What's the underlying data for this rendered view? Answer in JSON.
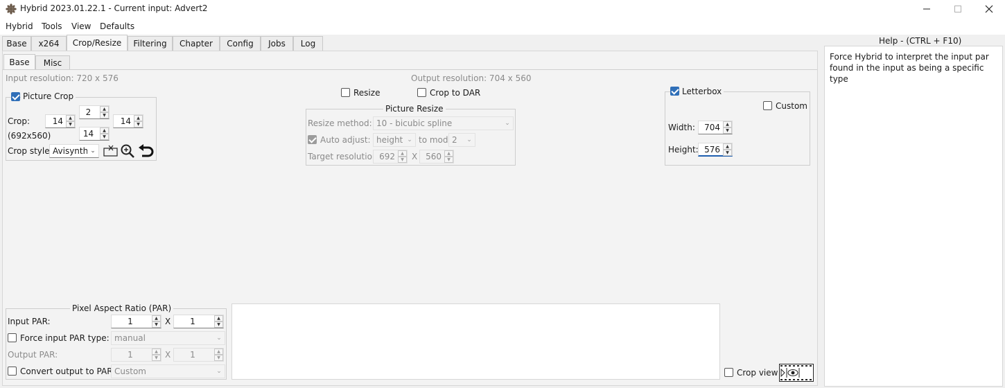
{
  "window": {
    "title": "Hybrid 2023.01.22.1 - Current input: Advert2"
  },
  "menu": [
    "Hybrid",
    "Tools",
    "View",
    "Defaults"
  ],
  "main_tabs": [
    "Base",
    "x264",
    "Crop/Resize",
    "Filtering",
    "Chapter",
    "Config",
    "Jobs",
    "Log"
  ],
  "active_main_tab": "Crop/Resize",
  "sub_tabs": [
    "Base",
    "Misc"
  ],
  "active_sub_tab": "Base",
  "resolution": {
    "input": "Input resolution: 720 x 576",
    "output": "Output resolution: 704 x 560"
  },
  "picture_crop": {
    "title": "Picture Crop",
    "checked": true,
    "crop_label": "Crop:",
    "top": "2",
    "left": "14",
    "right": "14",
    "bottom": "14",
    "dims": "(692x560)",
    "style_label": "Crop style:",
    "style_value": "Avisynth"
  },
  "resize": {
    "resize_label": "Resize",
    "resize_checked": false,
    "crop_to_dar_label": "Crop to DAR",
    "crop_to_dar_checked": false,
    "group_title": "Picture Resize",
    "method_label": "Resize method:",
    "method_value": "10 - bicubic spline",
    "auto_adjust_label": "Auto adjust:",
    "auto_adjust_checked": true,
    "auto_adjust_value": "height",
    "to_mod_label": "to mod",
    "mod_value": "2",
    "target_label": "Target resolution:",
    "target_w": "692",
    "target_x": "X",
    "target_h": "560"
  },
  "letterbox": {
    "label": "Letterbox",
    "checked": true,
    "custom_label": "Custom",
    "custom_checked": false,
    "width_label": "Width:",
    "width": "704",
    "height_label": "Height:",
    "height": "576"
  },
  "par": {
    "title": "Pixel Aspect Ratio (PAR)",
    "input_label": "Input PAR:",
    "input_a": "1",
    "input_x": "X",
    "input_b": "1",
    "force_label": "Force input PAR type:",
    "force_checked": false,
    "force_value": "manual",
    "output_label": "Output PAR:",
    "output_a": "1",
    "output_x": "X",
    "output_b": "1",
    "convert_label": "Convert output to PAR:",
    "convert_checked": false,
    "convert_value": "Custom"
  },
  "crop_view": {
    "label": "Crop view",
    "checked": false
  },
  "help": {
    "title": "Help - (CTRL + F10)",
    "text": "Force Hybrid to interpret the input par found in the input as being a specific type"
  },
  "colors": {
    "accent": "#2f6fb8",
    "background": "#f0f0f0"
  }
}
